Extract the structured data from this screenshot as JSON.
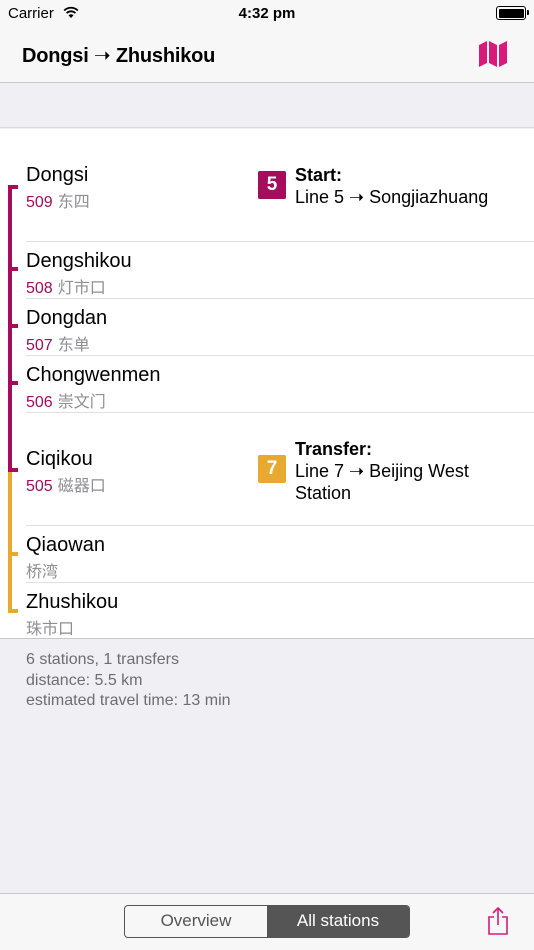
{
  "status_bar": {
    "carrier": "Carrier",
    "time": "4:32 pm"
  },
  "nav": {
    "title": "Dongsi ➝ Zhushikou"
  },
  "colors": {
    "line5": "#a50c5b",
    "line7": "#e8a931",
    "accent": "#d81b7a",
    "segment": "#555555"
  },
  "stations": [
    {
      "name": "Dongsi",
      "code": "509",
      "chinese": "东四",
      "line": "5"
    },
    {
      "name": "Dengshikou",
      "code": "508",
      "chinese": "灯市口",
      "line": "5"
    },
    {
      "name": "Dongdan",
      "code": "507",
      "chinese": "东单",
      "line": "5"
    },
    {
      "name": "Chongwenmen",
      "code": "506",
      "chinese": "崇文门",
      "line": "5"
    },
    {
      "name": "Ciqikou",
      "code": "505",
      "chinese": "磁器口",
      "line": "7"
    },
    {
      "name": "Qiaowan",
      "code": "",
      "chinese": "桥湾",
      "line": "7"
    },
    {
      "name": "Zhushikou",
      "code": "",
      "chinese": "珠市口",
      "line": "7"
    }
  ],
  "events": {
    "start": {
      "badge": "5",
      "heading": "Start:",
      "detail": "Line 5 ➝ Songjiazhuang"
    },
    "transfer": {
      "badge": "7",
      "heading": "Transfer:",
      "detail": "Line 7 ➝ Beijing West Station"
    }
  },
  "summary": {
    "line1": "6 stations, 1 transfers",
    "line2": "distance: 5.5 km",
    "line3": "estimated travel time: 13 min"
  },
  "toolbar": {
    "overview_label": "Overview",
    "all_stations_label": "All stations"
  }
}
